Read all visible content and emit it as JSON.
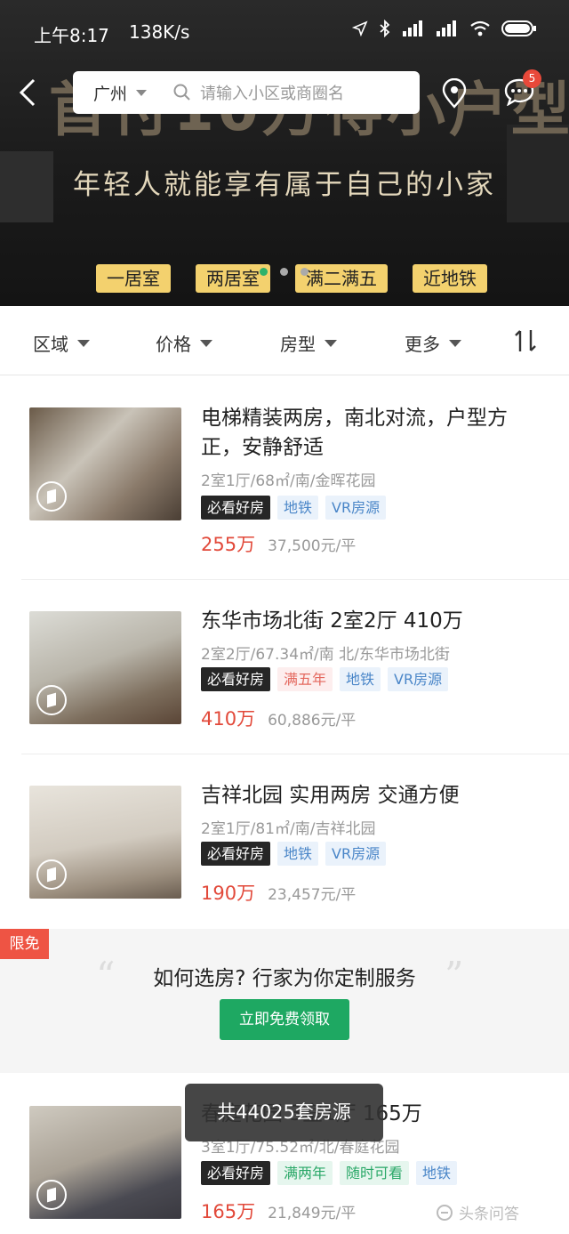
{
  "status": {
    "time": "上午8:17",
    "speed": "138K/s"
  },
  "banner": {
    "headline": "首付10万得小户型",
    "slogan": "年轻人就能享有属于自己的小家",
    "chips": [
      "一居室",
      "两居室",
      "满二满五",
      "近地铁"
    ]
  },
  "search": {
    "city": "广州",
    "placeholder": "请输入小区或商圈名"
  },
  "messages_badge": "5",
  "filters": [
    "区域",
    "价格",
    "房型",
    "更多"
  ],
  "listings": [
    {
      "title": "电梯精装两房，南北对流，户型方正，安静舒适",
      "sub": "2室1厅/68㎡/南/金晖花园",
      "tags": [
        {
          "t": "必看好房",
          "c": "dark"
        },
        {
          "t": "地铁",
          "c": "blue"
        },
        {
          "t": "VR房源",
          "c": "blue"
        }
      ],
      "price": "255万",
      "unit_price": "37,500元/平"
    },
    {
      "title": "东华市场北街 2室2厅 410万",
      "sub": "2室2厅/67.34㎡/南 北/东华市场北街",
      "tags": [
        {
          "t": "必看好房",
          "c": "dark"
        },
        {
          "t": "满五年",
          "c": "red"
        },
        {
          "t": "地铁",
          "c": "blue"
        },
        {
          "t": "VR房源",
          "c": "blue"
        }
      ],
      "price": "410万",
      "unit_price": "60,886元/平"
    },
    {
      "title": "吉祥北园 实用两房 交通方便",
      "sub": "2室1厅/81㎡/南/吉祥北园",
      "tags": [
        {
          "t": "必看好房",
          "c": "dark"
        },
        {
          "t": "地铁",
          "c": "blue"
        },
        {
          "t": "VR房源",
          "c": "blue"
        }
      ],
      "price": "190万",
      "unit_price": "23,457元/平"
    },
    {
      "title": "春庭花园 3室1厅 165万",
      "sub": "3室1厅/75.52㎡/北/春庭花园",
      "tags": [
        {
          "t": "必看好房",
          "c": "dark"
        },
        {
          "t": "满两年",
          "c": "green"
        },
        {
          "t": "随时可看",
          "c": "green"
        },
        {
          "t": "地铁",
          "c": "blue"
        }
      ],
      "price": "165万",
      "unit_price": "21,849元/平"
    }
  ],
  "ad": {
    "badge": "限免",
    "question": "如何选房? 行家为你定制服务",
    "cta": "立即免费领取"
  },
  "toast": "共44025套房源",
  "watermark": "头条问答"
}
